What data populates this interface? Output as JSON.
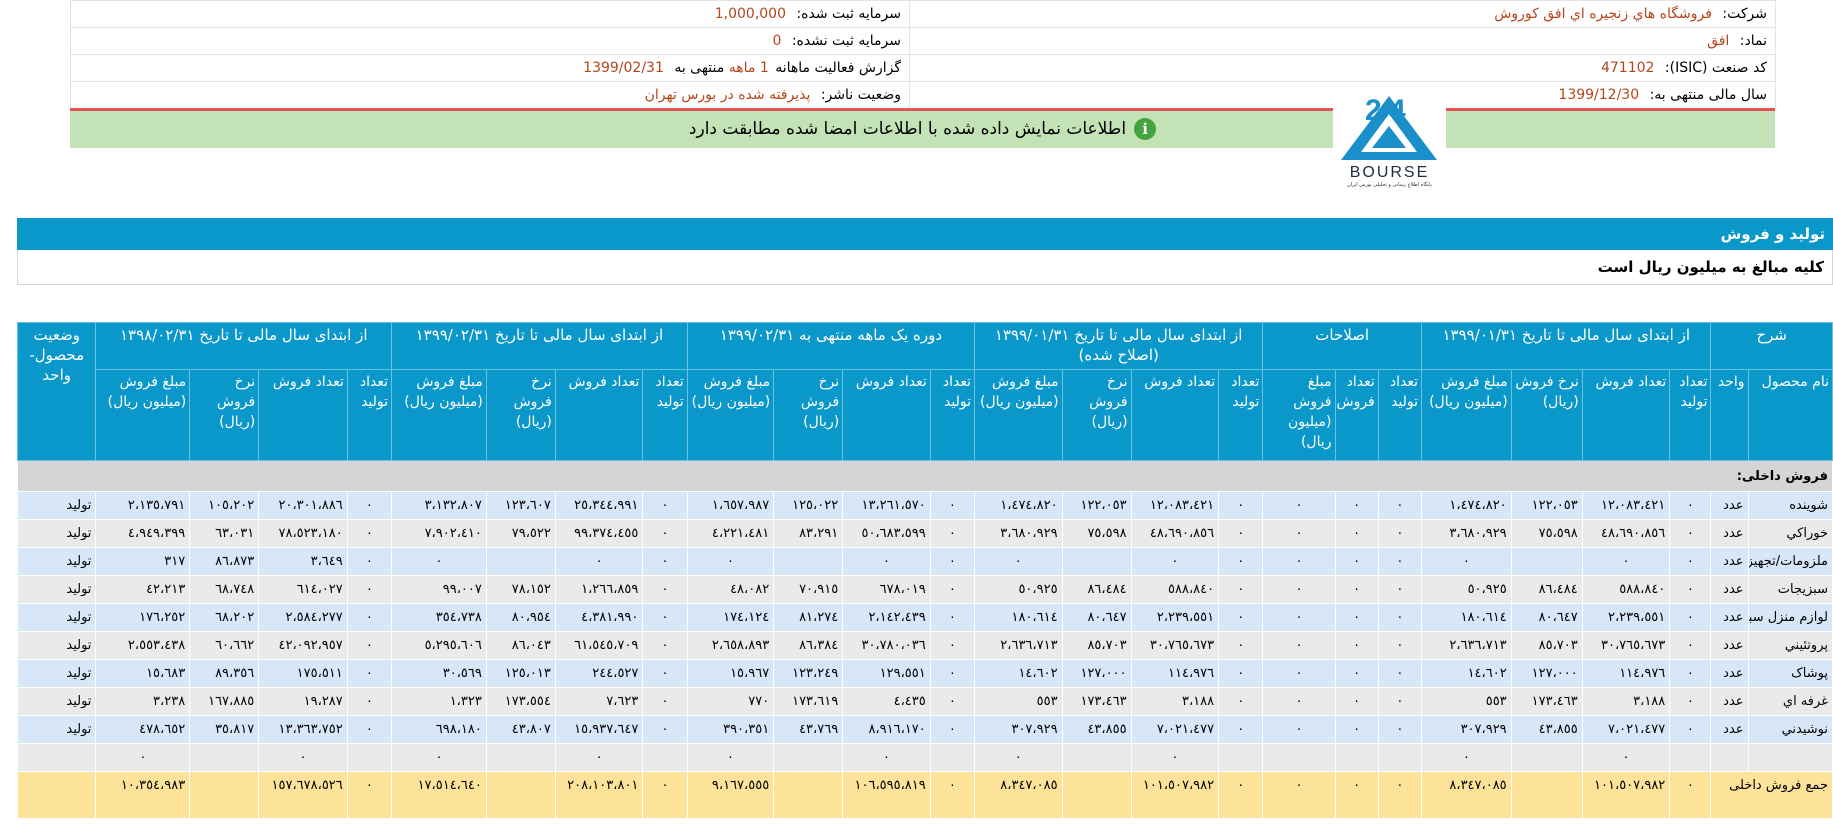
{
  "info": {
    "company_label": "شرکت:",
    "company_value": "فروشگاه هاي زنجيره اي افق كوروش",
    "registered_capital_label": "سرمایه ثبت شده:",
    "registered_capital_value": "1,000,000",
    "symbol_label": "نماد:",
    "symbol_value": "افق",
    "unregistered_capital_label": "سرمایه ثبت نشده:",
    "unregistered_capital_value": "0",
    "isic_label": "کد صنعت (ISIC):",
    "isic_value": "471102",
    "report_label_a": "گزارش فعالیت ماهانه",
    "report_value_months": "1 ماهه",
    "report_label_b": "منتهی به",
    "report_value_date": "1399/02/31",
    "fiscal_year_label": "سال مالی منتهی به:",
    "fiscal_year_value": "1399/12/30",
    "publisher_status_label": "وضعیت ناشر:",
    "publisher_status_value": "پذیرفته شده در بورس تهران"
  },
  "notice": {
    "text": "اطلاعات نمایش داده شده با اطلاعات امضا شده مطابقت دارد",
    "icon": "info-icon",
    "icon_glyph": "i"
  },
  "logo": {
    "brand_text": "BOURSE",
    "sub_text": "پایگاه اطلاع رسانی و تحلیلی بورس ایران",
    "color_primary": "#1b8fc9"
  },
  "section": {
    "title": "تولید و فروش",
    "note": "کلیه مبالغ به میلیون ریال است"
  },
  "table": {
    "group_headers": {
      "desc": "شرح",
      "period1": "از ابتدای سال مالی تا تاریخ ۱۳۹۹/۰۱/۳۱",
      "corrections": "اصلاحات",
      "period1_corrected": "از ابتدای سال مالی تا تاریخ ۱۳۹۹/۰۱/۳۱ (اصلاح شده)",
      "one_month": "دوره یک ماهه منتهی به ۱۳۹۹/۰۲/۳۱",
      "period2": "از ابتدای سال مالی تا تاریخ ۱۳۹۹/۰۲/۳۱",
      "prev_year": "از ابتدای سال مالی تا تاریخ ۱۳۹۸/۰۲/۳۱",
      "status": "وضعیت محصول-واحد"
    },
    "sub_headers": {
      "product": "نام محصول",
      "unit": "واحد",
      "prod_qty": "تعداد تولید",
      "sales_qty": "تعداد فروش",
      "rate": "نرخ فروش (ریال)",
      "amount": "مبلغ فروش (میلیون ریال)",
      "corr_prod_qty": "تعداد تولید",
      "corr_sales_qty": "تعداد فروش",
      "corr_amount": "مبلغ فروش (میلیون ریال)"
    },
    "group_label": "فروش داخلی:",
    "rows": [
      {
        "name": "شوینده",
        "unit": "عدد",
        "c": [
          "٠",
          "١٢،٠٨٣،٤٢١",
          "١٢٢،٠٥٣",
          "١،٤٧٤،٨٢٠",
          "٠",
          "٠",
          "٠",
          "٠",
          "١٢،٠٨٣،٤٢١",
          "١٢٢،٠٥٣",
          "١،٤٧٤،٨٢٠",
          "٠",
          "١٣،٢٦١،٥٧٠",
          "١٢٥،٠٢٢",
          "١،٦٥٧،٩٨٧",
          "٠",
          "٢٥،٣٤٤،٩٩١",
          "١٢٣،٦٠٧",
          "٣،١٣٢،٨٠٧",
          "٠",
          "٢٠،٣٠١،٨٨٦",
          "١٠٥،٢٠٢",
          "٢،١٣٥،٧٩١"
        ],
        "status": "تولید"
      },
      {
        "name": "خوراکي",
        "unit": "عدد",
        "c": [
          "٠",
          "٤٨،٦٩٠،٨٥٦",
          "٧٥،٥٩٨",
          "٣،٦٨٠،٩٢٩",
          "٠",
          "٠",
          "٠",
          "٠",
          "٤٨،٦٩٠،٨٥٦",
          "٧٥،٥٩٨",
          "٣،٦٨٠،٩٢٩",
          "٠",
          "٥٠،٦٨٣،٥٩٩",
          "٨٣،٢٩١",
          "٤،٢٢١،٤٨١",
          "٠",
          "٩٩،٣٧٤،٤٥٥",
          "٧٩،٥٢٢",
          "٧،٩٠٢،٤١٠",
          "٠",
          "٧٨،٥٢٣،١٨٠",
          "٦٣،٠٣١",
          "٤،٩٤٩،٣٩٩"
        ],
        "status": "تولید"
      },
      {
        "name": "ملزومات/تجهيزات",
        "unit": "عدد",
        "c": [
          "٠",
          "٠",
          "",
          "٠",
          "٠",
          "٠",
          "٠",
          "٠",
          "٠",
          "",
          "٠",
          "٠",
          "٠",
          "",
          "٠",
          "٠",
          "٠",
          "",
          "٠",
          "٠",
          "٣،٦٤٩",
          "٨٦،٨٧٣",
          "٣١٧"
        ],
        "status": "تولید"
      },
      {
        "name": "سبزيجات",
        "unit": "عدد",
        "c": [
          "٠",
          "٥٨٨،٨٤٠",
          "٨٦،٤٨٤",
          "٥٠،٩٢٥",
          "٠",
          "٠",
          "٠",
          "٠",
          "٥٨٨،٨٤٠",
          "٨٦،٤٨٤",
          "٥٠،٩٢٥",
          "٠",
          "٦٧٨،٠١٩",
          "٧٠،٩١٥",
          "٤٨،٠٨٢",
          "٠",
          "١،٢٦٦،٨٥٩",
          "٧٨،١٥٢",
          "٩٩،٠٠٧",
          "٠",
          "٦١٤،٠٢٧",
          "٦٨،٧٤٨",
          "٤٢،٢١٣"
        ],
        "status": "تولید"
      },
      {
        "name": "لوازم منزل سبک",
        "unit": "عدد",
        "c": [
          "٠",
          "٢،٢٣٩،٥٥١",
          "٨٠،٦٤٧",
          "١٨٠،٦١٤",
          "٠",
          "٠",
          "٠",
          "٠",
          "٢،٢٣٩،٥٥١",
          "٨٠،٦٤٧",
          "١٨٠،٦١٤",
          "٠",
          "٢،١٤٢،٤٣٩",
          "٨١،٢٧٤",
          "١٧٤،١٢٤",
          "٠",
          "٤،٣٨١،٩٩٠",
          "٨٠،٩٥٤",
          "٣٥٤،٧٣٨",
          "٠",
          "٢،٥٨٤،٢٧٧",
          "٦٨،٢٠٢",
          "١٧٦،٢٥٢"
        ],
        "status": "تولید"
      },
      {
        "name": "پروتئيني",
        "unit": "عدد",
        "c": [
          "٠",
          "٣٠،٧٦٥،٦٧٣",
          "٨٥،٧٠٣",
          "٢،٦٣٦،٧١٣",
          "٠",
          "٠",
          "٠",
          "٠",
          "٣٠،٧٦٥،٦٧٣",
          "٨٥،٧٠٣",
          "٢،٦٣٦،٧١٣",
          "٠",
          "٣٠،٧٨٠،٠٣٦",
          "٨٦،٣٨٤",
          "٢،٦٥٨،٨٩٣",
          "٠",
          "٦١،٥٤٥،٧٠٩",
          "٨٦،٠٤٣",
          "٥،٢٩٥،٦٠٦",
          "٠",
          "٤٢،٠٩٢،٩٥٧",
          "٦٠،٦٦٢",
          "٢،٥٥٣،٤٣٨"
        ],
        "status": "تولید"
      },
      {
        "name": "پوشاک",
        "unit": "عدد",
        "c": [
          "٠",
          "١١٤،٩٧٦",
          "١٢٧،٠٠٠",
          "١٤،٦٠٢",
          "٠",
          "٠",
          "٠",
          "٠",
          "١١٤،٩٧٦",
          "١٢٧،٠٠٠",
          "١٤،٦٠٢",
          "٠",
          "١٢٩،٥٥١",
          "١٢٣،٢٤٩",
          "١٥،٩٦٧",
          "٠",
          "٢٤٤،٥٢٧",
          "١٢٥،٠١٣",
          "٣٠،٥٦٩",
          "٠",
          "١٧٥،٥١١",
          "٨٩،٣٥٦",
          "١٥،٦٨٣"
        ],
        "status": "تولید"
      },
      {
        "name": "غرفه اي",
        "unit": "عدد",
        "c": [
          "٠",
          "٣،١٨٨",
          "١٧٣،٤٦٣",
          "٥٥٣",
          "٠",
          "٠",
          "٠",
          "٠",
          "٣،١٨٨",
          "١٧٣،٤٦٣",
          "٥٥٣",
          "٠",
          "٤،٤٣٥",
          "١٧٣،٦١٩",
          "٧٧٠",
          "٠",
          "٧،٦٢٣",
          "١٧٣،٥٥٤",
          "١،٣٢٣",
          "٠",
          "١٩،٢٨٧",
          "١٦٧،٨٨٥",
          "٣،٢٣٨"
        ],
        "status": "تولید"
      },
      {
        "name": "نوشيدني",
        "unit": "عدد",
        "c": [
          "٠",
          "٧،٠٢١،٤٧٧",
          "٤٣،٨٥٥",
          "٣٠٧،٩٢٩",
          "٠",
          "٠",
          "٠",
          "٠",
          "٧،٠٢١،٤٧٧",
          "٤٣،٨٥٥",
          "٣٠٧،٩٢٩",
          "٠",
          "٨،٩١٦،١٧٠",
          "٤٣،٧٦٩",
          "٣٩٠،٣٥١",
          "٠",
          "١٥،٩٣٧،٦٤٧",
          "٤٣،٨٠٧",
          "٦٩٨،١٨٠",
          "٠",
          "١٣،٣٦٣،٧٥٢",
          "٣٥،٨١٧",
          "٤٧٨،٦٥٢"
        ],
        "status": "تولید"
      },
      {
        "name": "",
        "unit": "",
        "c": [
          "",
          "٠",
          "",
          "٠",
          "",
          "",
          "",
          "",
          "٠",
          "",
          "٠",
          "",
          "٠",
          "",
          "٠",
          "",
          "٠",
          "",
          "٠",
          "",
          "٠",
          "",
          "٠"
        ],
        "status": ""
      }
    ],
    "total": {
      "name": "جمع فروش داخلی",
      "c": [
        "٠",
        "١٠١،٥٠٧،٩٨٢",
        "",
        "٨،٣٤٧،٠٨٥",
        "٠",
        "٠",
        "٠",
        "٠",
        "١٠١،٥٠٧،٩٨٢",
        "",
        "٨،٣٤٧،٠٨٥",
        "٠",
        "١٠٦،٥٩٥،٨١٩",
        "",
        "٩،١٦٧،٥٥٥",
        "٠",
        "٢٠٨،١٠٣،٨٠١",
        "",
        "١٧،٥١٤،٦٤٠",
        "٠",
        "١٥٧،٦٧٨،٥٢٦",
        "",
        "١٠،٣٥٤،٩٨٣"
      ]
    }
  }
}
